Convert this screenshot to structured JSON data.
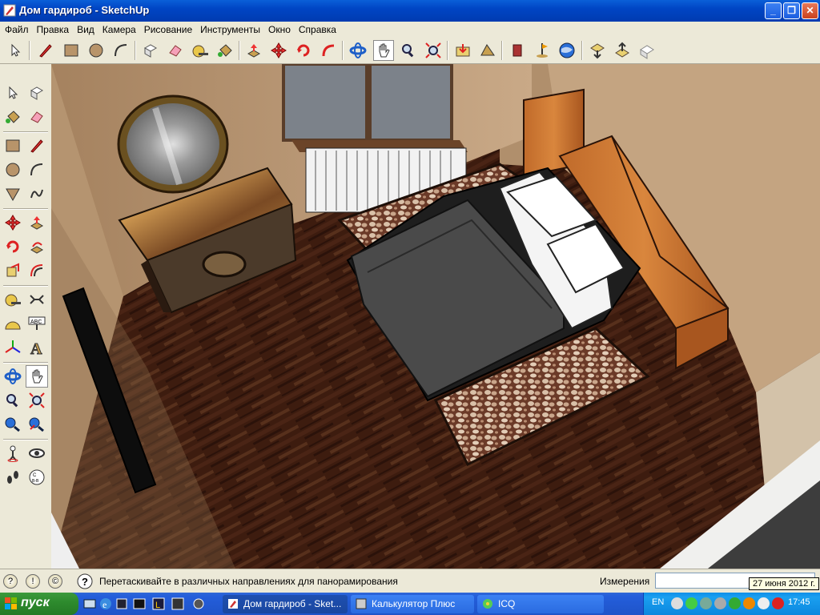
{
  "window": {
    "title": "Дом гардироб - SketchUp",
    "minimize_label": "_",
    "maximize_label": "❐",
    "close_label": "✕"
  },
  "menu": [
    "Файл",
    "Правка",
    "Вид",
    "Камера",
    "Рисование",
    "Инструменты",
    "Окно",
    "Справка"
  ],
  "toolbar_icons": [
    "select-icon",
    "pencil-icon",
    "rectangle-icon",
    "circle-icon",
    "arc-icon",
    "make-component-icon",
    "eraser-icon",
    "tape-measure-icon",
    "paint-bucket-icon",
    "push-pull-icon",
    "move-icon",
    "rotate-icon",
    "follow-me-icon",
    "orbit-icon",
    "pan-icon",
    "zoom-icon",
    "zoom-extents-icon",
    "get-models-icon",
    "share-model-icon",
    "component-icon",
    "place-model-icon",
    "google-earth-icon",
    "add-location-icon",
    "toggle-terrain-icon",
    "photo-texture-icon"
  ],
  "left_toolbar_icons": [
    "select-icon",
    "make-component-icon",
    "paint-bucket-icon",
    "eraser-icon",
    "rectangle-icon",
    "line-icon",
    "circle-icon",
    "arc-icon",
    "polygon-icon",
    "freehand-icon",
    "move-icon",
    "push-pull-icon",
    "rotate-icon",
    "follow-me-icon",
    "scale-icon",
    "offset-icon",
    "tape-measure-icon",
    "dimension-icon",
    "protractor-icon",
    "text-icon",
    "axes-icon",
    "3d-text-icon",
    "orbit-icon",
    "pan-icon",
    "zoom-icon",
    "zoom-window-icon",
    "previous-view-icon",
    "zoom-extents-icon",
    "position-camera-icon",
    "look-around-icon",
    "walk-icon",
    "section-plane-icon"
  ],
  "status": {
    "hint": "Перетаскивайте в различных направлениях для панорамирования",
    "measurements_label": "Измерения",
    "measurements_value": ""
  },
  "tooltip": "27 июня 2012 г.",
  "taskbar": {
    "start_label": "пуск",
    "tasks": [
      "Дом гардироб - Sket...",
      "Калькулятор Плюс",
      "ICQ"
    ],
    "lang": "EN",
    "clock": "17:45"
  },
  "colors": {
    "titlebar": "#0045c4",
    "floor": "#3a1d10",
    "wall": "#c9a987",
    "taskbar": "#245edb",
    "start": "#2e8b2e"
  }
}
